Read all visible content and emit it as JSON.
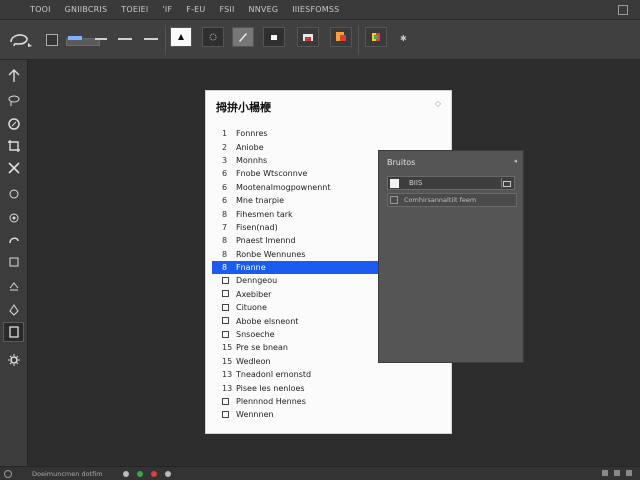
{
  "menu": {
    "items": [
      "TOOI",
      "GNIIBCRIS",
      "TOEIEI",
      "'IF",
      "F-EU",
      "FSII",
      "NNVEG",
      "IIIESFOMSS"
    ]
  },
  "doc_panel": {
    "title": "拇拚小楊楩",
    "items": [
      {
        "num": "1",
        "label": "Fonnres"
      },
      {
        "num": "2",
        "label": "Aniobe"
      },
      {
        "num": "3",
        "label": "Monnhs"
      },
      {
        "num": "6",
        "label": "Fnobe Wtsconnve"
      },
      {
        "num": "6",
        "label": "Mootenalmogpownennt"
      },
      {
        "num": "6",
        "label": "Mne tnarpie"
      },
      {
        "num": "8",
        "label": "Fihesmen tark"
      },
      {
        "num": "7",
        "label": "Fisen(nad)"
      },
      {
        "num": "8",
        "label": "Pnaest lmennd"
      },
      {
        "num": "8",
        "label": "Ronbe Wennunes"
      },
      {
        "num": "8",
        "label": "Fnanne"
      },
      {
        "num": "",
        "label": "Denngeou"
      },
      {
        "num": "",
        "label": "Axebiber"
      },
      {
        "num": "",
        "label": "Cituone"
      },
      {
        "num": "",
        "label": "Abobe elsneont"
      },
      {
        "num": "",
        "label": "Snsoeche"
      },
      {
        "num": "15",
        "label": "Pre se bnean"
      },
      {
        "num": "15",
        "label": "Wedleon"
      },
      {
        "num": "13",
        "label": "Tneadonl ernonstd"
      },
      {
        "num": "13",
        "label": "Pisee les nenloes"
      },
      {
        "num": "",
        "label": "Plennnod Hennes"
      },
      {
        "num": "",
        "label": "Wennnen"
      }
    ]
  },
  "side_panel": {
    "title": "Bruitos",
    "field1": "BIIS",
    "field2": "Comhirsannaltiit feem"
  },
  "status": {
    "text": "Doeimuncmen dotfim"
  },
  "colors": {
    "selection": "#1a5cf0"
  }
}
